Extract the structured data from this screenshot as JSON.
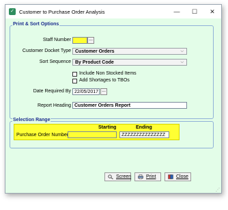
{
  "window": {
    "title": "Customer to Purchase Order Analysis",
    "minimize": "—",
    "maximize": "☐",
    "close": "✕"
  },
  "print_sort": {
    "legend": "Print & Sort Options",
    "staff_number_label": "Staff Number",
    "staff_number_value": "",
    "ellipsis": "...",
    "docket_type_label": "Customer Docket Type",
    "docket_type_value": "Customer Orders",
    "sort_sequence_label": "Sort Sequence",
    "sort_sequence_value": "By Product Code",
    "include_non_stocked_label": "Include Non Stocked Items",
    "include_non_stocked_checked": false,
    "add_shortages_label": "Add Shortages to TBOs",
    "add_shortages_checked": false,
    "date_required_label": "Date Required By",
    "date_required_value": "22/05/2017",
    "report_heading_label": "Report Heading",
    "report_heading_value": "Customer Orders Report"
  },
  "selection_range": {
    "legend": "Selection Range",
    "starting_header": "Starting",
    "ending_header": "Ending",
    "po_number_label": "Purchase Order Number",
    "po_starting_value": "",
    "po_ending_value": "ZZZZZZZZZZZZZZZ"
  },
  "buttons": {
    "screen": "Screen",
    "print": "Print",
    "close": "Close"
  },
  "colors": {
    "background": "#e3fde8",
    "highlight": "#ffff33",
    "legend_text": "#1d2e8f"
  }
}
